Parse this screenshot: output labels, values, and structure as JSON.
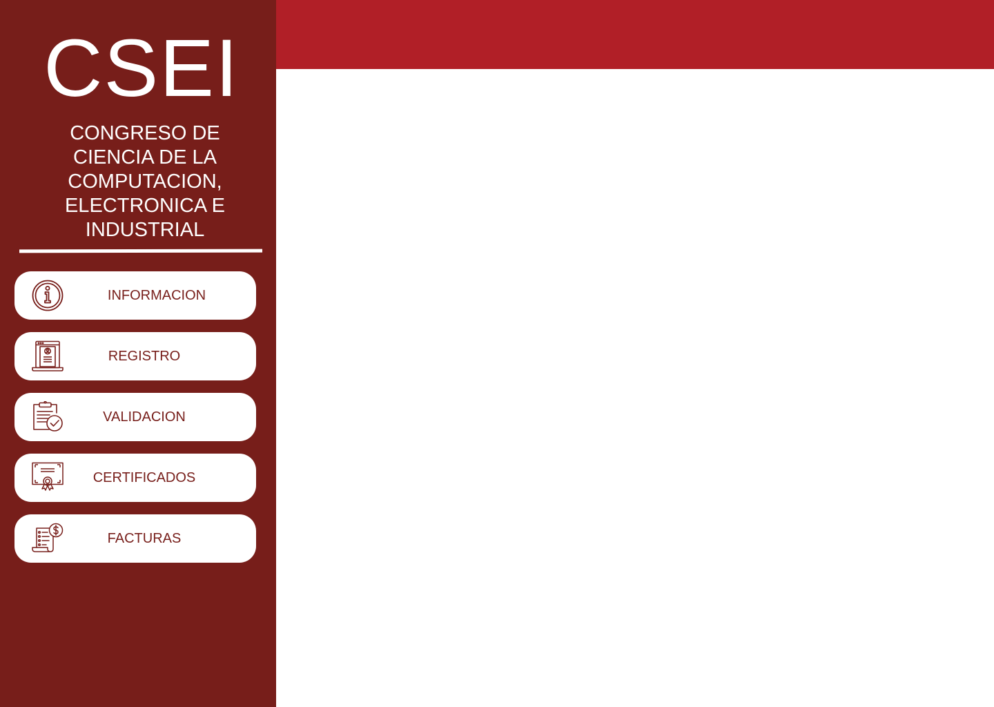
{
  "sidebar": {
    "logo": "CSEI",
    "subtitle": "CONGRESO DE CIENCIA DE LA COMPUTACION, ELECTRONICA E INDUSTRIAL",
    "items": [
      {
        "label": "INFORMACION",
        "icon": "info-icon"
      },
      {
        "label": "REGISTRO",
        "icon": "registration-icon"
      },
      {
        "label": "VALIDACION",
        "icon": "validation-clipboard-icon"
      },
      {
        "label": "CERTIFICADOS",
        "icon": "certificate-icon"
      },
      {
        "label": "FACTURAS",
        "icon": "invoice-icon"
      }
    ]
  },
  "colors": {
    "sidebar_bg": "#771e1a",
    "topbar_bg": "#b11f27",
    "button_bg": "#ffffff",
    "button_text": "#771e1a",
    "content_bg": "#ffffff"
  }
}
